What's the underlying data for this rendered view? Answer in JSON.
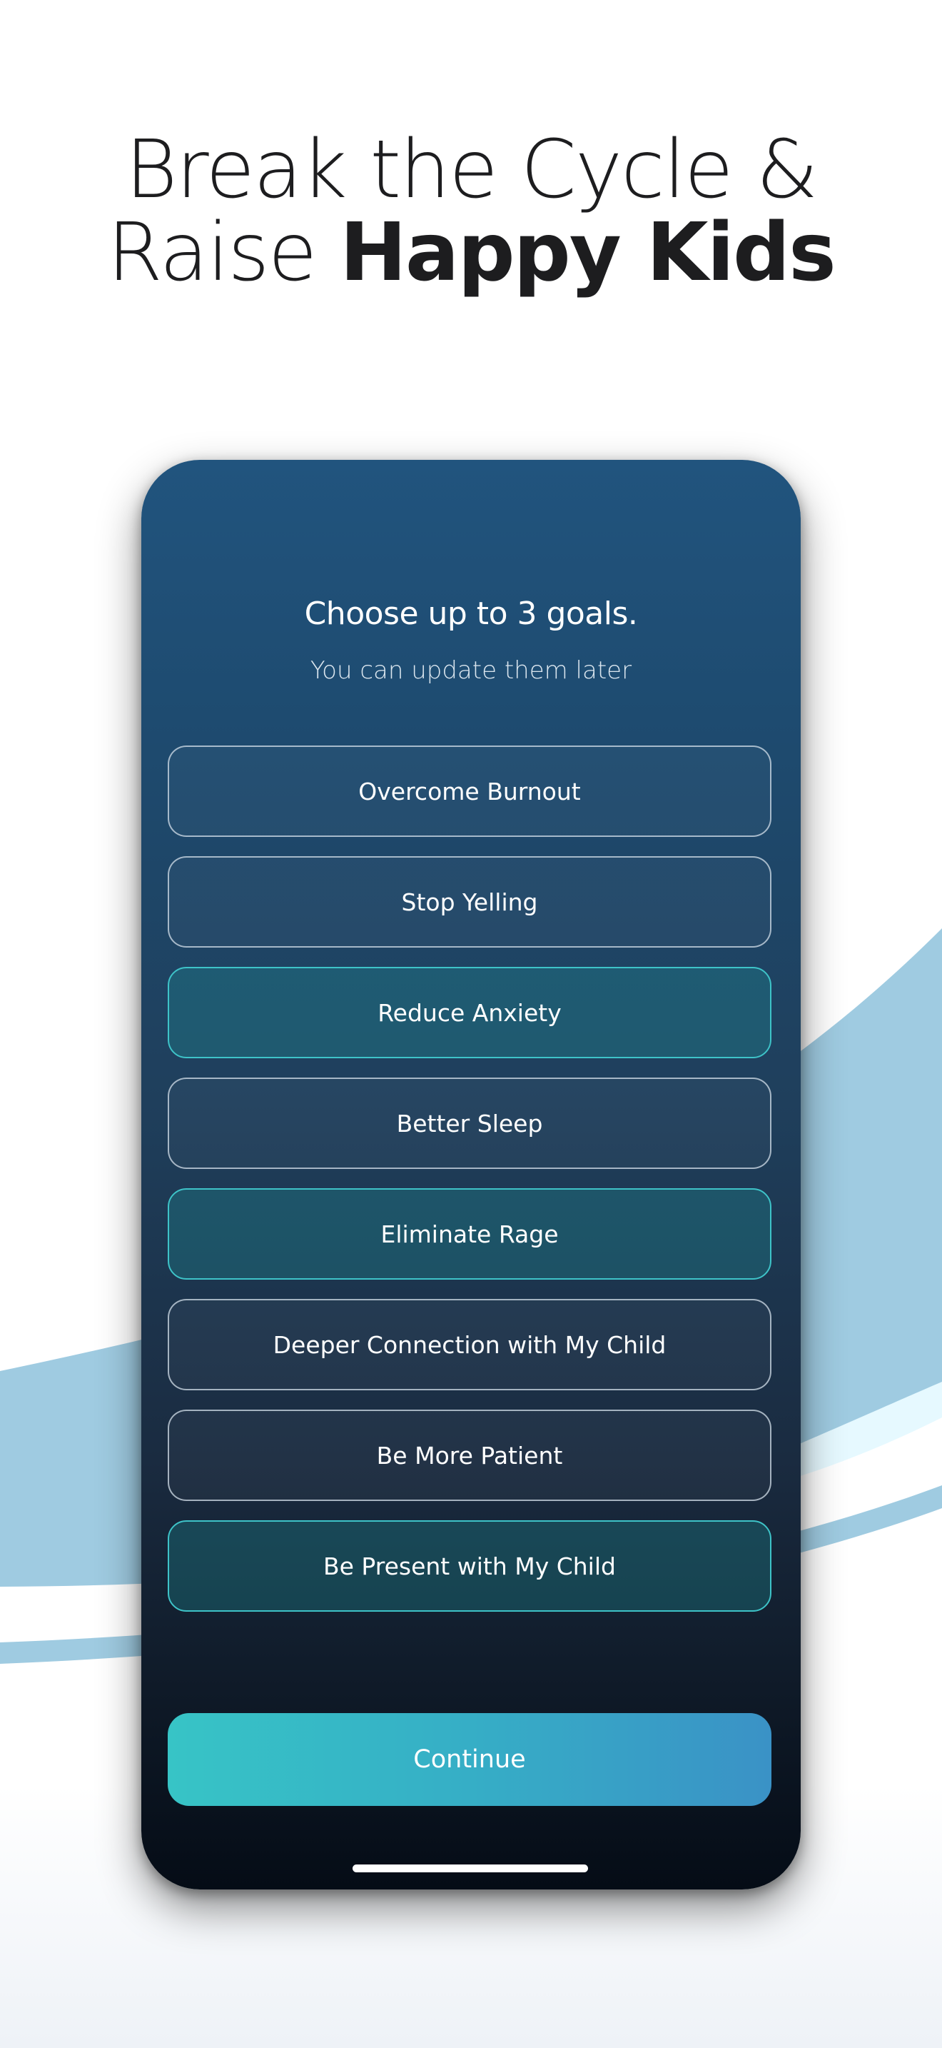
{
  "headline": {
    "line1": "Break the Cycle &",
    "line2_prefix": "Raise ",
    "line2_bold": "Happy Kids"
  },
  "screen": {
    "title": "Choose up to 3 goals.",
    "subtitle": "You can update them later",
    "goals": [
      {
        "label": "Overcome Burnout",
        "selected": false
      },
      {
        "label": "Stop Yelling",
        "selected": false
      },
      {
        "label": "Reduce Anxiety",
        "selected": true
      },
      {
        "label": "Better Sleep",
        "selected": false
      },
      {
        "label": "Eliminate Rage",
        "selected": true
      },
      {
        "label": "Deeper Connection with My Child",
        "selected": false
      },
      {
        "label": "Be More Patient",
        "selected": false
      },
      {
        "label": "Be Present with My Child",
        "selected": true
      }
    ],
    "continue_label": "Continue"
  },
  "colors": {
    "accent": "#3ec3c8",
    "wave": "#9fcbe1",
    "phone_top": "#21547e",
    "phone_bottom": "#050c16",
    "headline": "#1d1d1f"
  }
}
